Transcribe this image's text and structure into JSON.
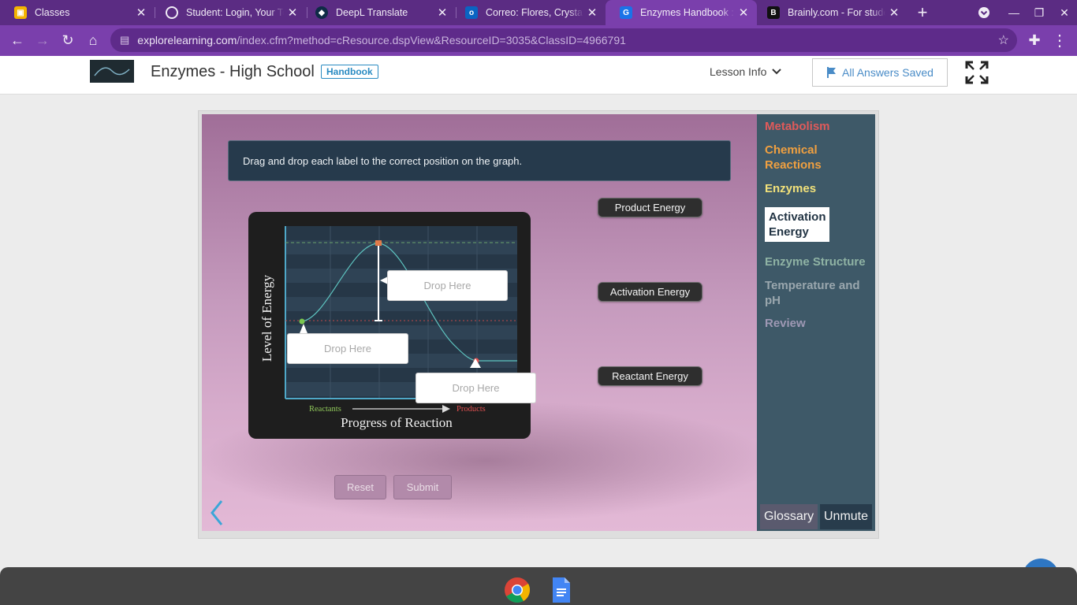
{
  "browser": {
    "tabs": [
      {
        "title": "Classes",
        "icon": "google-classroom-icon",
        "color": "#f4b400",
        "active": false
      },
      {
        "title": "Student: Login, Your Te",
        "icon": "globe-icon",
        "color": "#5b2c83",
        "active": false
      },
      {
        "title": "DeepL Translate",
        "icon": "deepl-icon",
        "color": "#0f2b46",
        "active": false
      },
      {
        "title": "Correo: Flores, Crystal -",
        "icon": "outlook-icon",
        "color": "#0a64c2",
        "active": false
      },
      {
        "title": "Enzymes Handbook : E",
        "icon": "explorelearning-icon",
        "color": "#1a73e8",
        "active": true
      },
      {
        "title": "Brainly.com - For stude",
        "icon": "brainly-icon",
        "color": "#111111",
        "active": false
      }
    ],
    "url_host": "explorelearning.com",
    "url_path": "/index.cfm?method=cResource.dspView&ResourceID=3035&ClassID=4966791"
  },
  "header": {
    "title": "Enzymes - High School",
    "badge": "Handbook",
    "lesson_info": "Lesson Info",
    "saved": "All Answers Saved"
  },
  "gizmo": {
    "instruction": "Drag and drop each label to the correct position on the graph.",
    "graph": {
      "y_axis_label": "Level of Energy",
      "x_axis_label": "Progress of Reaction",
      "reactants_label": "Reactants",
      "products_label": "Products"
    },
    "drop_zones": [
      "Drop Here",
      "Drop Here",
      "Drop Here"
    ],
    "labels": [
      "Product Energy",
      "Activation Energy",
      "Reactant Energy"
    ],
    "reset": "Reset",
    "submit": "Submit"
  },
  "sidemenu": {
    "items": [
      {
        "label": "Metabolism",
        "color": "#e05a5a"
      },
      {
        "label": "Chemical Reactions",
        "color": "#f0a040"
      },
      {
        "label": "Enzymes",
        "color": "#f2e27a"
      },
      {
        "label": "Enzyme Structure",
        "color": "#8fb3a4"
      },
      {
        "label": "Temperature and pH",
        "color": "#9aa7ae"
      },
      {
        "label": "Review",
        "color": "#9e98b4"
      }
    ],
    "active": "Activation Energy",
    "glossary": "Glossary",
    "unmute": "Unmute"
  }
}
